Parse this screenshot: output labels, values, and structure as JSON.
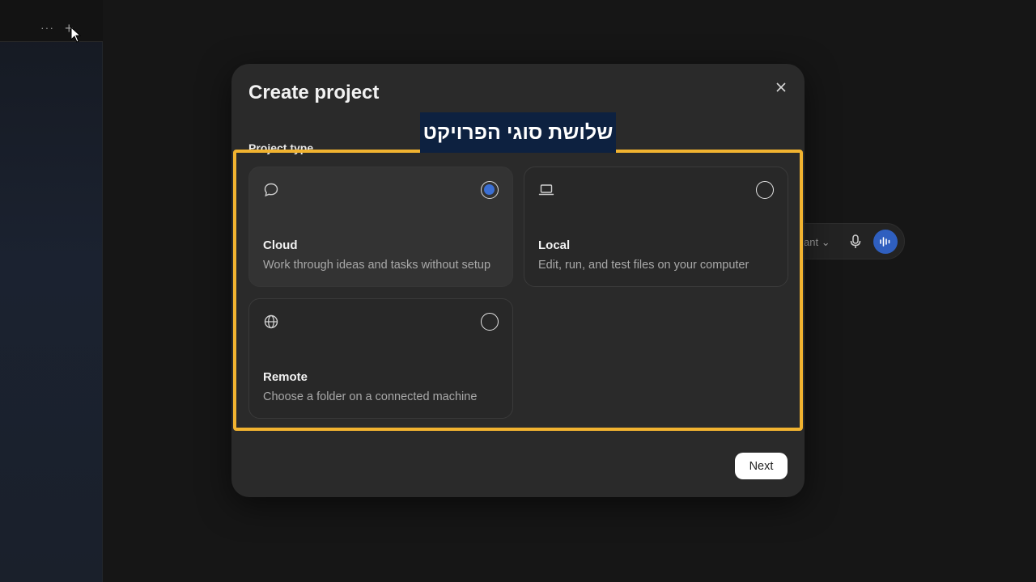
{
  "sidebar": {
    "more_glyph": "···",
    "add_glyph": "+"
  },
  "composer": {
    "model_partial": "ant"
  },
  "modal": {
    "title": "Create project",
    "section_label": "Project type",
    "overlay_caption": "שלושת סוגי הפרויקט",
    "options": [
      {
        "id": "cloud",
        "title": "Cloud",
        "description": "Work through ideas and tasks without setup",
        "icon": "chat-bubble-icon",
        "selected": true
      },
      {
        "id": "local",
        "title": "Local",
        "description": "Edit, run, and test files on your computer",
        "icon": "laptop-icon",
        "selected": false
      },
      {
        "id": "remote",
        "title": "Remote",
        "description": "Choose a folder on a connected machine",
        "icon": "globe-icon",
        "selected": false
      }
    ],
    "next_label": "Next"
  },
  "colors": {
    "accent": "#3b6fd4",
    "highlight_border": "#f1b330",
    "caption_bg": "#0d2140"
  }
}
